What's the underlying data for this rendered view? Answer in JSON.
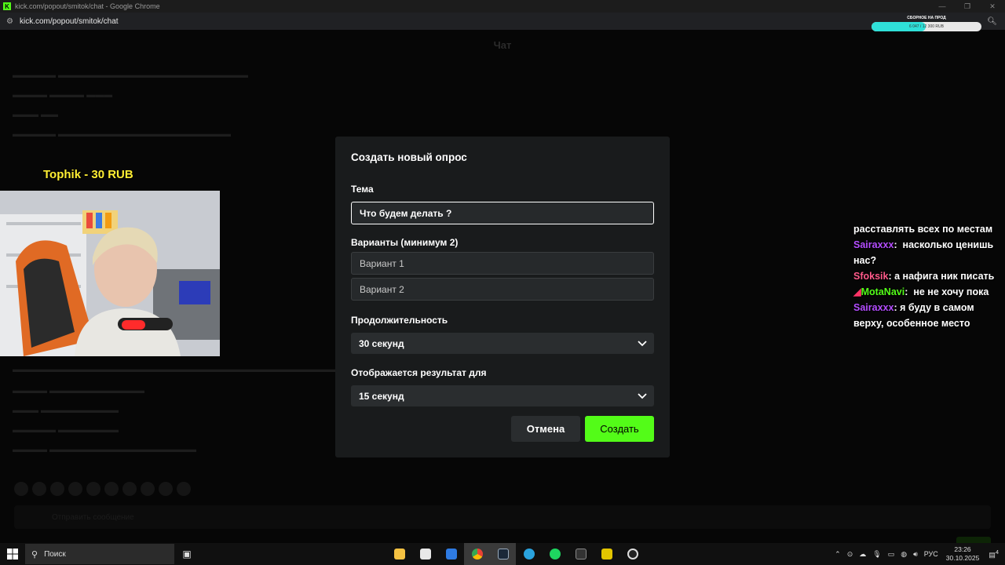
{
  "browser": {
    "window_title": "kick.com/popout/smitok/chat - Google Chrome",
    "url": "kick.com/popout/smitok/chat",
    "controls": [
      "—",
      "❐",
      "✕"
    ]
  },
  "goal": {
    "label": "СБОРНОЕ НА ПРОД",
    "amount": "6 047 / 12 300 RUB",
    "progress": 0.49
  },
  "chat": {
    "header": "Чат",
    "input_placeholder": "Отправить сообщение"
  },
  "overlay": {
    "donation": "Tophik - 30 RUB",
    "messages": [
      {
        "user": "",
        "color": "#ffffff",
        "text": "расставлять всех по местам"
      },
      {
        "user": "Sairaxxx",
        "color": "#b44dff",
        "text": "насколько ценишь нас?"
      },
      {
        "user": "Sfoksik",
        "color": "#ff5a8a",
        "text": "а нафига ник писать"
      },
      {
        "user": "MotaNavi",
        "color": "#53fc18",
        "text": "не не хочу пока"
      },
      {
        "user": "Sairaxxx",
        "color": "#b44dff",
        "text": "я буду в самом верху, особенное место"
      }
    ]
  },
  "modal": {
    "title": "Создать новый опрос",
    "topic_label": "Тема",
    "topic_value": "Что будем делать ?",
    "options_label": "Варианты (минимум 2)",
    "option1_placeholder": "Вариант 1",
    "option2_placeholder": "Вариант 2",
    "duration_label": "Продолжительность",
    "duration_value": "30 секунд",
    "result_label": "Отображается результат для",
    "result_value": "15 секунд",
    "cancel_label": "Отмена",
    "create_label": "Создать"
  },
  "taskbar": {
    "search_label": "Поиск",
    "language": "РУС",
    "time": "23:26",
    "date": "30.10.2025",
    "notification_count": "4"
  },
  "colors": {
    "accent": "#53fc18",
    "modal_bg": "#191b1c"
  }
}
